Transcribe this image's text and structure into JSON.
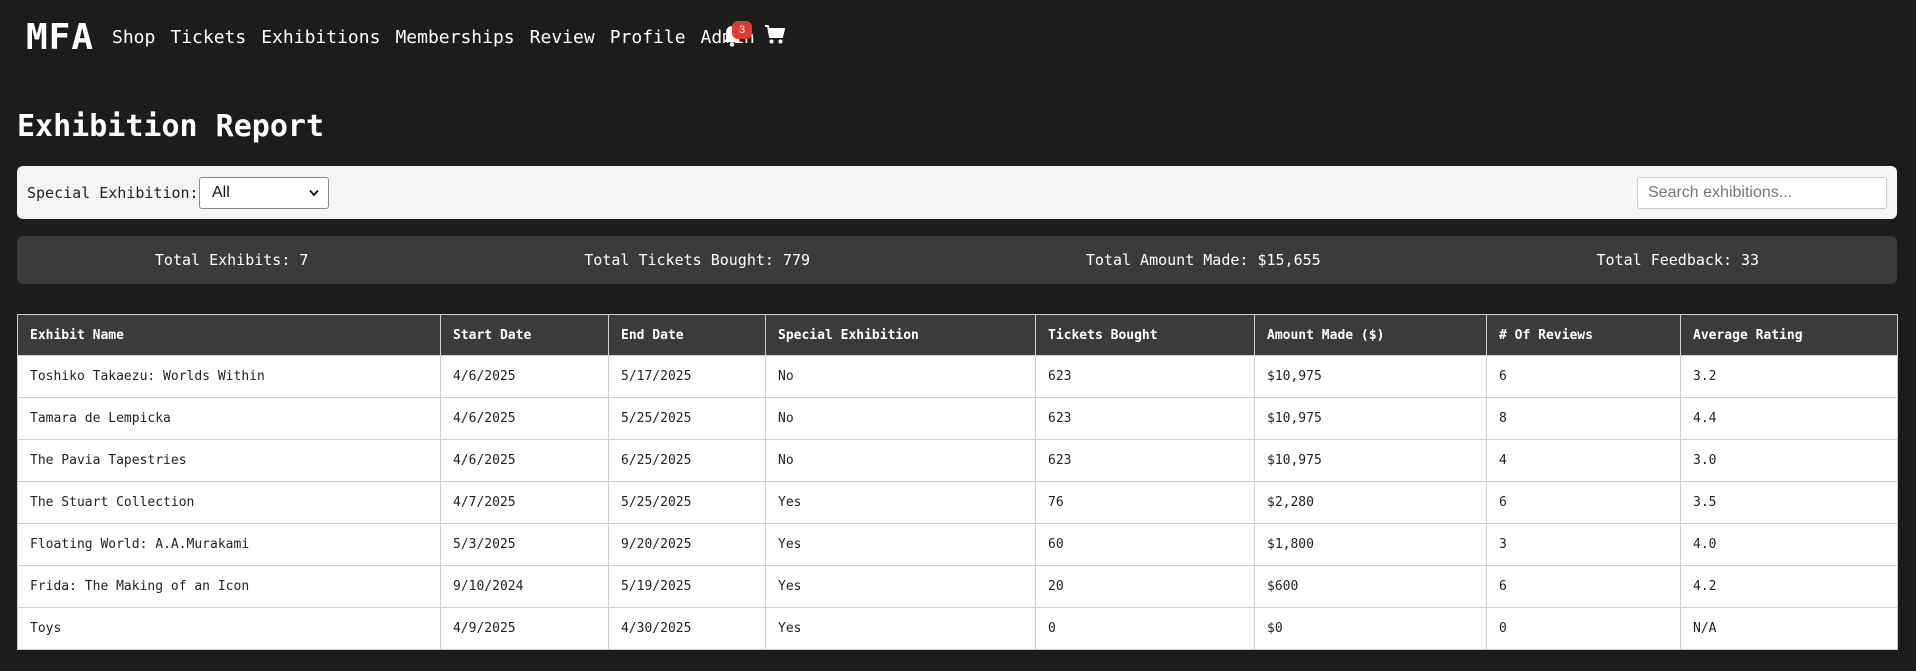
{
  "nav": {
    "logo": "MFA",
    "links": [
      "Shop",
      "Tickets",
      "Exhibitions",
      "Memberships",
      "Review",
      "Profile",
      "Admin"
    ],
    "notification_count": "3",
    "icons": {
      "notifications": "bell-icon",
      "cart": "cart-icon"
    }
  },
  "page": {
    "title": "Exhibition Report"
  },
  "filter": {
    "label": "Special Exhibition:",
    "selected": "All",
    "search_placeholder": "Search exhibitions..."
  },
  "summary": {
    "total_exhibits": "Total Exhibits: 7",
    "total_tickets": "Total Tickets Bought: 779",
    "total_amount": "Total Amount Made: $15,655",
    "total_feedback": "Total Feedback: 33"
  },
  "table": {
    "headers": [
      "Exhibit Name",
      "Start Date",
      "End Date",
      "Special Exhibition",
      "Tickets Bought",
      "Amount Made ($)",
      "# Of Reviews",
      "Average Rating"
    ],
    "rows": [
      [
        "Toshiko Takaezu: Worlds Within",
        "4/6/2025",
        "5/17/2025",
        "No",
        "623",
        "$10,975",
        "6",
        "3.2"
      ],
      [
        "Tamara de Lempicka",
        "4/6/2025",
        "5/25/2025",
        "No",
        "623",
        "$10,975",
        "8",
        "4.4"
      ],
      [
        "The Pavia Tapestries",
        "4/6/2025",
        "6/25/2025",
        "No",
        "623",
        "$10,975",
        "4",
        "3.0"
      ],
      [
        "The Stuart Collection",
        "4/7/2025",
        "5/25/2025",
        "Yes",
        "76",
        "$2,280",
        "6",
        "3.5"
      ],
      [
        "Floating World: A.A.Murakami",
        "5/3/2025",
        "9/20/2025",
        "Yes",
        "60",
        "$1,800",
        "3",
        "4.0"
      ],
      [
        "Frida: The Making of an Icon",
        "9/10/2024",
        "5/19/2025",
        "Yes",
        "20",
        "$600",
        "6",
        "4.2"
      ],
      [
        "Toys",
        "4/9/2025",
        "4/30/2025",
        "Yes",
        "0",
        "$0",
        "0",
        "N/A"
      ]
    ]
  },
  "colors": {
    "background": "#1d1c1b",
    "panel_dark": "#3b3b3b",
    "filter_bar": "#f5f5f5",
    "badge": "#e03a32"
  }
}
